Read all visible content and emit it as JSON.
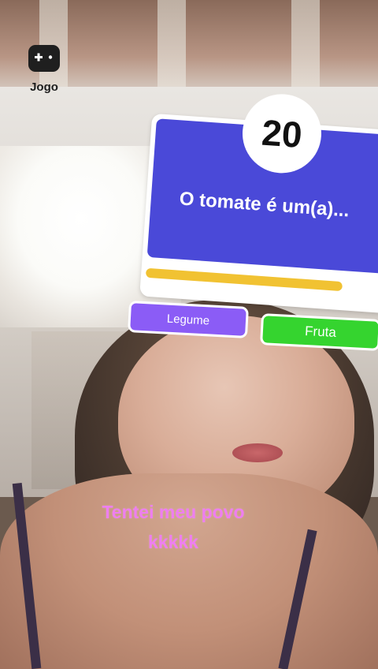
{
  "overlay": {
    "game_launcher": {
      "icon": "gamepad-icon",
      "label": "Jogo"
    }
  },
  "quiz": {
    "timer": "20",
    "question": "O tomate é um(a)...",
    "answers": [
      "Legume",
      "Fruta"
    ],
    "answer_colors": {
      "left": "#8b5cf6",
      "right": "#35d42f"
    },
    "card_color": "#4a49d8",
    "progress_color": "#f1c232"
  },
  "caption": {
    "lines": [
      "Tentei meu povo",
      "kkkkk"
    ],
    "color": "#ee7ef0"
  }
}
